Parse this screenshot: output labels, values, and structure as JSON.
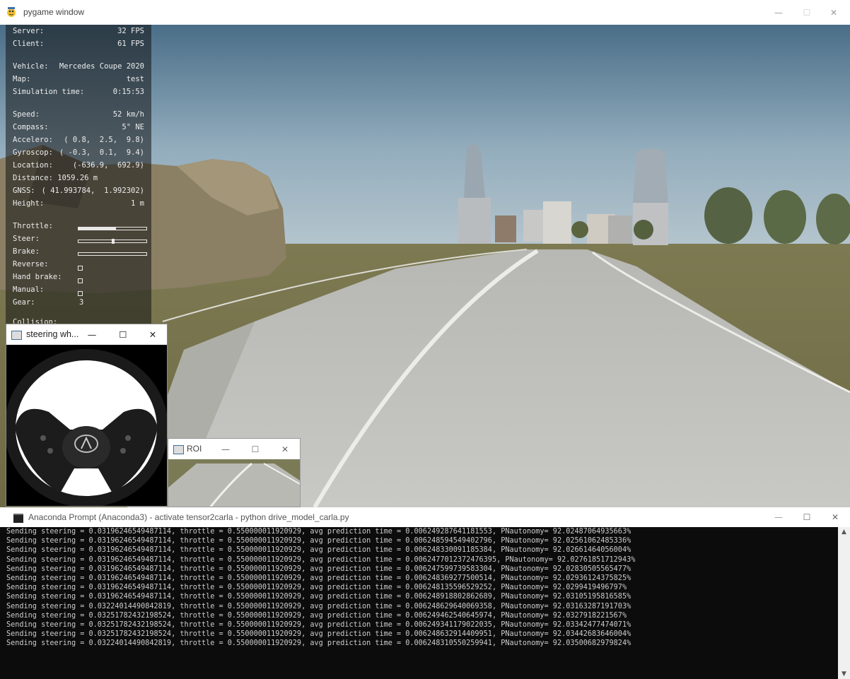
{
  "pygame": {
    "title": "pygame window",
    "hud": {
      "rows": [
        {
          "label": "Server:",
          "value": "32 FPS"
        },
        {
          "label": "Client:",
          "value": "61 FPS"
        },
        {
          "label": "Vehicle:",
          "value": "Mercedes Coupe 2020"
        },
        {
          "label": "Map:",
          "value": "test"
        },
        {
          "label": "Simulation time:",
          "value": "0:15:53"
        },
        {
          "label": "Speed:",
          "value": "52 km/h"
        },
        {
          "label": "Compass:",
          "value": "5° NE"
        },
        {
          "label": "Accelero:",
          "value": "( 0.8,  2.5,  9.8)"
        },
        {
          "label": "Gyroscop:",
          "value": "( -0.3,  0.1,  9.4)"
        },
        {
          "label": "Location:",
          "value": "(-636.9,  692.9)"
        },
        {
          "label": "Distance: 1059.26 m",
          "value": ""
        },
        {
          "label": "GNSS:",
          "value": "( 41.993784,  1.992302)"
        },
        {
          "label": "Height:",
          "value": "1 m"
        }
      ],
      "controls": {
        "throttle_label": "Throttle:",
        "steer_label": "Steer:",
        "brake_label": "Brake:",
        "reverse_label": "Reverse:",
        "handbrake_label": "Hand brake:",
        "manual_label": "Manual:",
        "gear_label": "Gear:",
        "gear_value": "3",
        "collision_label": "Collision:",
        "throttle_level": 0.55,
        "steer_level": 0.03,
        "brake_level": 0
      }
    }
  },
  "steering_window": {
    "title": "steering wh..."
  },
  "roi_window": {
    "title": "ROI"
  },
  "window_controls": {
    "minimize": "—",
    "maximize": "☐",
    "close": "✕"
  },
  "anaconda": {
    "title": "Anaconda Prompt (Anaconda3) - activate  tensor2carla - python  drive_model_carla.py",
    "lines": [
      "Sending steering = 0.03196246549487114, throttle = 0.550000011920929, avg prediction time = 0.006249287641181553, PNautonomy= 92.02487064935663%",
      "Sending steering = 0.03196246549487114, throttle = 0.550000011920929, avg prediction time = 0.006248594549402796, PNautonomy= 92.02561062485336%",
      "Sending steering = 0.03196246549487114, throttle = 0.550000011920929, avg prediction time = 0.006248330091185384, PNautonomy= 92.02661464056004%",
      "Sending steering = 0.03196246549487114, throttle = 0.550000011920929, avg prediction time = 0.0062477012372476395, PNautonomy= 92.02761851712943%",
      "Sending steering = 0.03196246549487114, throttle = 0.550000011920929, avg prediction time = 0.006247599739583304, PNautonomy= 92.02830505565477%",
      "Sending steering = 0.03196246549487114, throttle = 0.550000011920929, avg prediction time = 0.006248369277500514, PNautonomy= 92.02936124375825%",
      "Sending steering = 0.03196246549487114, throttle = 0.550000011920929, avg prediction time = 0.006248135596529252, PNautonomy= 92.0299419496797%",
      "Sending steering = 0.03196246549487114, throttle = 0.550000011920929, avg prediction time = 0.006248918802862689, PNautonomy= 92.03105195816585%",
      "Sending steering = 0.03224014490842819, throttle = 0.550000011920929, avg prediction time = 0.006248629640069358, PNautonomy= 92.03163287191703%",
      "Sending steering = 0.03251782432198524, throttle = 0.550000011920929, avg prediction time = 0.006249462540645974, PNautonomy= 92.0327918221567%",
      "Sending steering = 0.03251782432198524, throttle = 0.550000011920929, avg prediction time = 0.006249341179022035, PNautonomy= 92.03342477474071%",
      "Sending steering = 0.03251782432198524, throttle = 0.550000011920929, avg prediction time = 0.006248632914409951, PNautonomy= 92.03442683646004%",
      "Sending steering = 0.03224014490842819, throttle = 0.550000011920929, avg prediction time = 0.006248310550259941, PNautonomy= 92.03500682979824%"
    ]
  }
}
